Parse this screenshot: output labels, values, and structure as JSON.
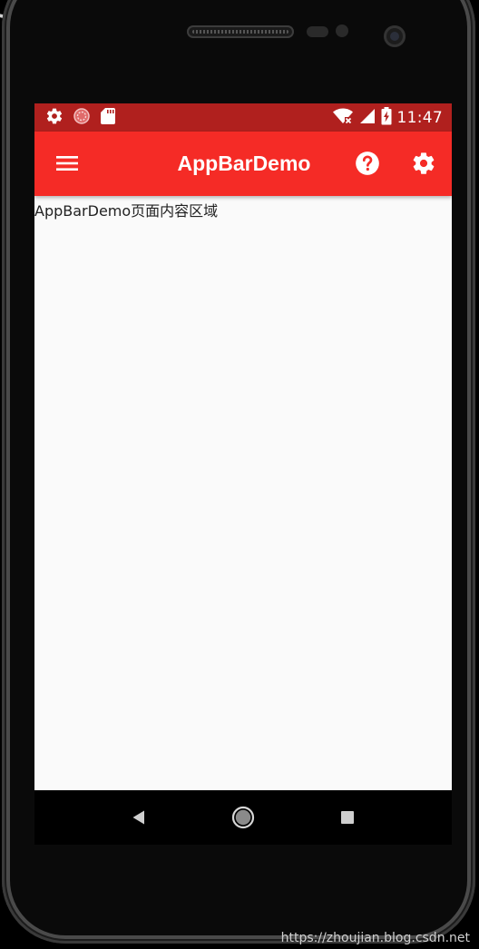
{
  "status_bar": {
    "time": "11:47",
    "left_icons": [
      "gear-icon",
      "sync-circle-icon",
      "sd-card-icon"
    ],
    "right_icons": [
      "wifi-icon",
      "signal-icon",
      "battery-charging-icon"
    ],
    "color": "#b0201e"
  },
  "app_bar": {
    "title": "AppBarDemo",
    "color": "#f52b26",
    "leading_icon": "menu-icon",
    "actions": [
      "help-icon",
      "settings-icon"
    ]
  },
  "body": {
    "text": "AppBarDemo页面内容区域"
  },
  "nav_bar": {
    "buttons": [
      "back-icon",
      "home-icon",
      "recent-apps-icon"
    ]
  },
  "watermark": "https://zhoujian.blog.csdn.net"
}
